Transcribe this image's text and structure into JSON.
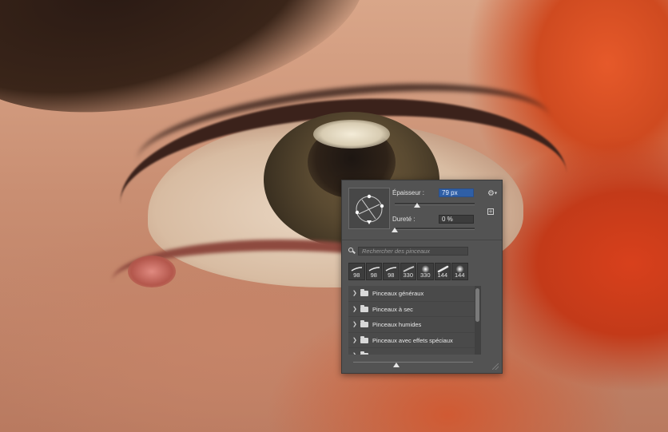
{
  "brush_panel": {
    "size_label": "Épaisseur :",
    "size_value": "79 px",
    "hardness_label": "Dureté :",
    "hardness_value": "0 %",
    "size_slider_fraction": 0.28,
    "hardness_slider_fraction": 0.0,
    "search_placeholder": "Rechercher des pinceaux",
    "settings_icon": "gear-icon",
    "new_preset_icon": "new-preset-icon",
    "recent_brushes": [
      {
        "size": "98",
        "tip": "hard-stroke"
      },
      {
        "size": "98",
        "tip": "hard-stroke"
      },
      {
        "size": "98",
        "tip": "hard-stroke"
      },
      {
        "size": "330",
        "tip": "soft-stroke"
      },
      {
        "size": "330",
        "tip": "soft-round"
      },
      {
        "size": "144",
        "tip": "taper-stroke"
      },
      {
        "size": "144",
        "tip": "soft-round"
      }
    ],
    "folders": [
      {
        "label": "Pinceaux généraux"
      },
      {
        "label": "Pinceaux à sec"
      },
      {
        "label": "Pinceaux humides"
      },
      {
        "label": "Pinceaux avec effets spéciaux"
      }
    ],
    "preview_size_fraction": 0.36,
    "accent_color": "#2f5fa6"
  }
}
